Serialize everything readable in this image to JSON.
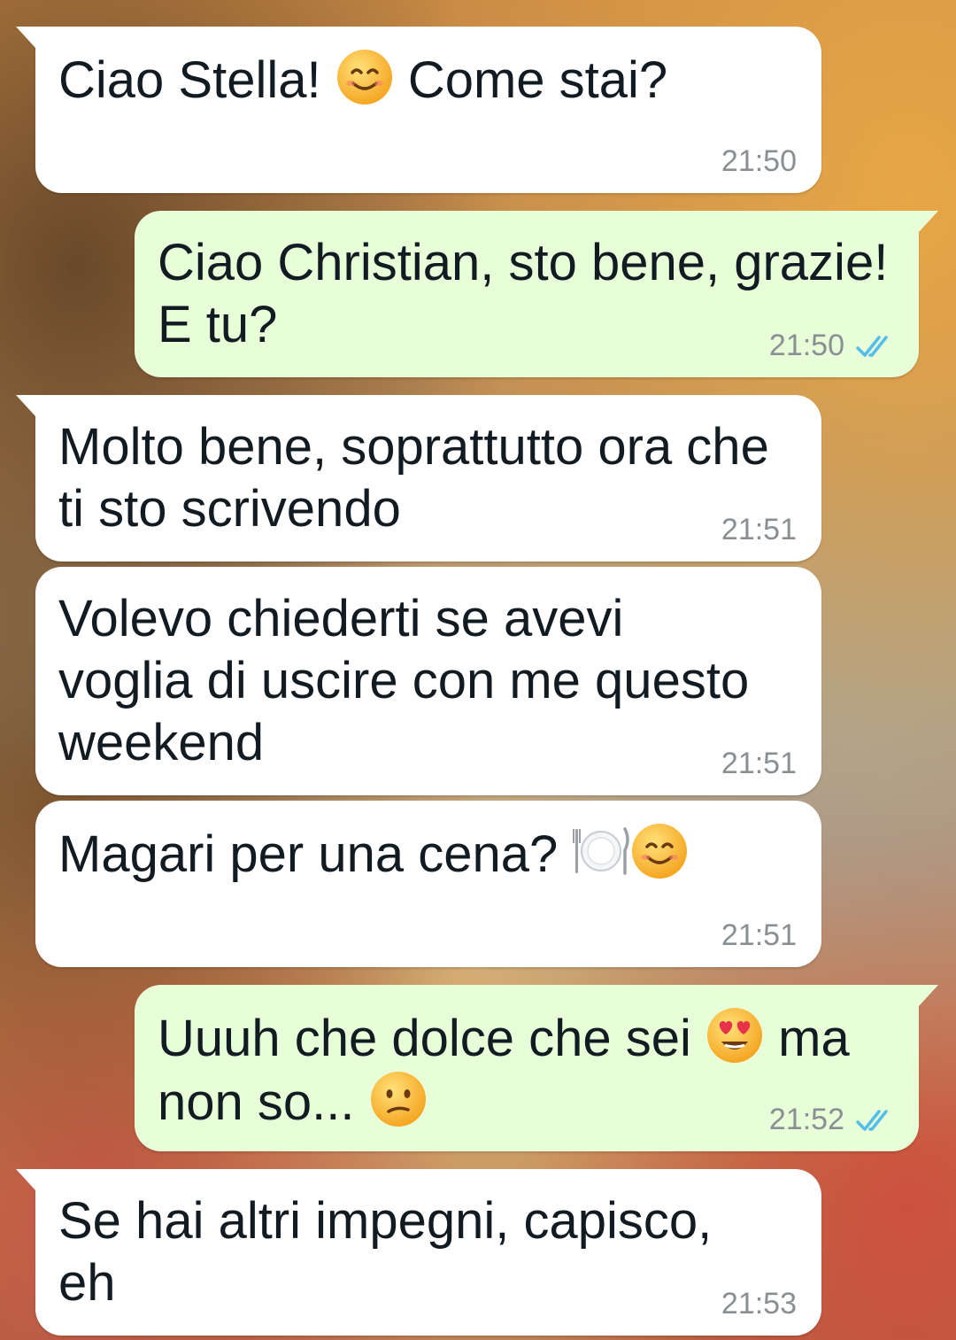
{
  "colors": {
    "incoming_bubble": "#ffffff",
    "outgoing_bubble": "#e7fed8",
    "timestamp": "#8a8f93",
    "read_ticks": "#53bdeb",
    "text": "#111b21"
  },
  "messages": [
    {
      "direction": "in",
      "text_before": "Ciao Stella! ",
      "emoji": "smiling-face-icon",
      "text_after": " Come stai?",
      "time": "21:50"
    },
    {
      "direction": "out",
      "text": "Ciao Christian, sto bene, grazie!\nE tu?",
      "time": "21:50",
      "status": "read"
    },
    {
      "direction": "in",
      "text": "Molto bene, soprattutto ora che\nti sto scrivendo",
      "time": "21:51"
    },
    {
      "direction": "in",
      "text": "Volevo chiederti se avevi\nvoglia di uscire con me questo\nweekend",
      "time": "21:51"
    },
    {
      "direction": "in",
      "text_before": "Magari per una cena? ",
      "emoji": [
        "fork-knife-plate-icon",
        "smiling-face-icon"
      ],
      "time": "21:51"
    },
    {
      "direction": "out",
      "text_before": "Uuuh che dolce che sei ",
      "emoji": [
        "heart-eyes-icon",
        "confused-face-icon"
      ],
      "text_after": " ma",
      "text_line2": "non so... ",
      "time": "21:52",
      "status": "read"
    },
    {
      "direction": "in",
      "text": "Se hai altri impegni, capisco,\neh",
      "time": "21:53"
    }
  ]
}
